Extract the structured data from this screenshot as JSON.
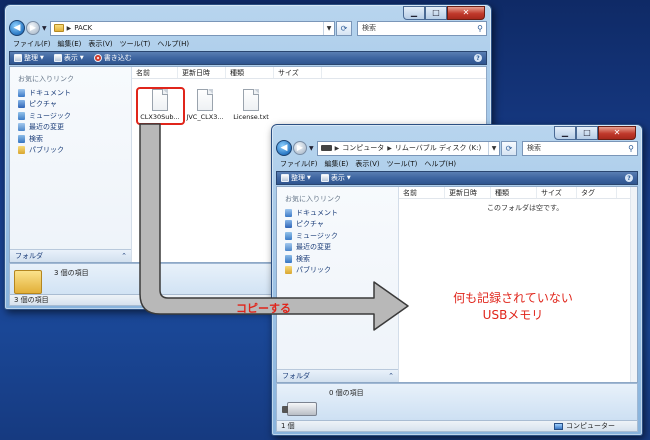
{
  "colors": {
    "accent_red": "#e0251b",
    "toolbar_blue": "#3e65a0",
    "desktop_blue": "#183e8c",
    "arrow_grey": "#b5b5b5"
  },
  "window1": {
    "address_path": "PACK",
    "search_placeholder": "検索",
    "menu": [
      "ファイル(F)",
      "編集(E)",
      "表示(V)",
      "ツール(T)",
      "ヘルプ(H)"
    ],
    "toolbar": {
      "organize": "整理",
      "view": "表示",
      "burn": "書き込む"
    },
    "favorites_title": "お気に入りリンク",
    "favorites": [
      "ドキュメント",
      "ピクチャ",
      "ミュージック",
      "最近の変更",
      "検索",
      "パブリック"
    ],
    "folder_label": "フォルダ",
    "columns": [
      "名前",
      "更新日時",
      "種類",
      "サイズ"
    ],
    "files": [
      "CLX30Sub...",
      "JVC_CLX3...",
      "License.txt"
    ],
    "details_count": "3 個の項目",
    "status_count": "3 個の項目"
  },
  "window2": {
    "address_parts": [
      "コンピュータ",
      "リムーバブル ディスク (K:)"
    ],
    "search_placeholder": "検索",
    "menu": [
      "ファイル(F)",
      "編集(E)",
      "表示(V)",
      "ツール(T)",
      "ヘルプ(H)"
    ],
    "toolbar": {
      "organize": "整理",
      "view": "表示"
    },
    "favorites_title": "お気に入りリンク",
    "favorites": [
      "ドキュメント",
      "ピクチャ",
      "ミュージック",
      "最近の変更",
      "検索",
      "パブリック"
    ],
    "folder_label": "フォルダ",
    "columns": [
      "名前",
      "更新日時",
      "種類",
      "サイズ",
      "タグ"
    ],
    "empty_message": "このフォルダは空です。",
    "details_count": "0 個の項目",
    "status_count": "1 個",
    "status_location": "コンピューター"
  },
  "annotation": {
    "copy_label": "コピーする",
    "note_line1": "何も記録されていない",
    "note_line2": "USBメモリ"
  }
}
